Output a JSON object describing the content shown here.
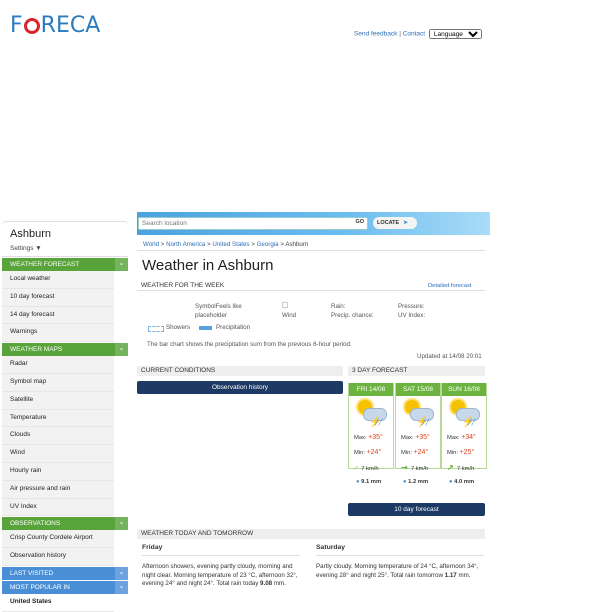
{
  "header": {
    "logo": "FORECA",
    "send_feedback": "Send feedback",
    "separator": "|",
    "contact": "Contact",
    "language": "Language"
  },
  "search": {
    "placeholder": "Search location",
    "go": "GO",
    "locate": "LOCATE"
  },
  "sidebar": {
    "city": "Ashburn",
    "settings": "Settings ▼",
    "sections": [
      {
        "title": "WEATHER FORECAST",
        "items": [
          "Local weather",
          "10 day forecast",
          "14 day forecast",
          "Warnings"
        ]
      },
      {
        "title": "WEATHER MAPS",
        "items": [
          "Radar",
          "Symbol map",
          "Satellite",
          "Temperature",
          "Clouds",
          "Wind",
          "Hourly rain",
          "Air pressure and rain",
          "UV Index"
        ]
      },
      {
        "title": "OBSERVATIONS",
        "items": [
          "Crisp County Cordele Airport",
          "Observation history"
        ]
      },
      {
        "title": "LAST VISITED",
        "items": []
      },
      {
        "title": "MOST POPULAR IN",
        "items": [
          "United States"
        ]
      }
    ]
  },
  "breadcrumb": [
    "World",
    "North America",
    "United States",
    "Georgia",
    "Ashburn"
  ],
  "page_title": "Weather in Ashburn",
  "week": {
    "heading": "WEATHER FOR THE WEEK",
    "detailed": "Detailed forecast",
    "symbol_alt": "SymbolFeels like placeholder",
    "wind_alt": "Wind",
    "rain_label": "Rain:",
    "precip_label": "Precip. chance:",
    "pressure_label": "Pressure:",
    "uv_label": "UV Index:",
    "legend_showers": "Showers",
    "legend_precip": "Precipitation",
    "note": "The bar chart shows the precipitation sum from the previous 6-hour period.",
    "updated": "Updated at 14/08 20:01"
  },
  "current": {
    "heading": "CURRENT CONDITIONS",
    "button": "Observation history"
  },
  "forecast": {
    "heading": "3 DAY FORECAST",
    "max_label": "Max:",
    "min_label": "Min:",
    "days": [
      {
        "date": "FRI 14/08",
        "max": "+35°",
        "min": "+24°",
        "wind": "7 km/h",
        "rain": "9.1 mm"
      },
      {
        "date": "SAT 15/08",
        "max": "+35°",
        "min": "+24°",
        "wind": "7 km/h",
        "rain": "1.2 mm"
      },
      {
        "date": "SUN 16/08",
        "max": "+34°",
        "min": "+25°",
        "wind": "7 km/h",
        "rain": "4.0 mm"
      }
    ],
    "ten_day_button": "10 day forecast"
  },
  "today_tomorrow": {
    "heading": "WEATHER TODAY AND TOMORROW",
    "friday": {
      "title": "Friday",
      "text": "Afternoon showers, evening partly cloudy, morning and night clear. Morning temperature of 23 °C, afternoon 32°, evening 24° and night 24°. Total rain today",
      "total": "9.08",
      "unit": "mm."
    },
    "saturday": {
      "title": "Saturday",
      "text": "Partly cloudy. Morning temperature of 24 °C, afternoon 34°, evening 28° and night 25°. Total rain tomorrow",
      "total": "1.17",
      "unit": "mm."
    }
  },
  "colors": {
    "green": "#58a33a",
    "blue": "#4a8fd6",
    "navy": "#1c3a63"
  }
}
